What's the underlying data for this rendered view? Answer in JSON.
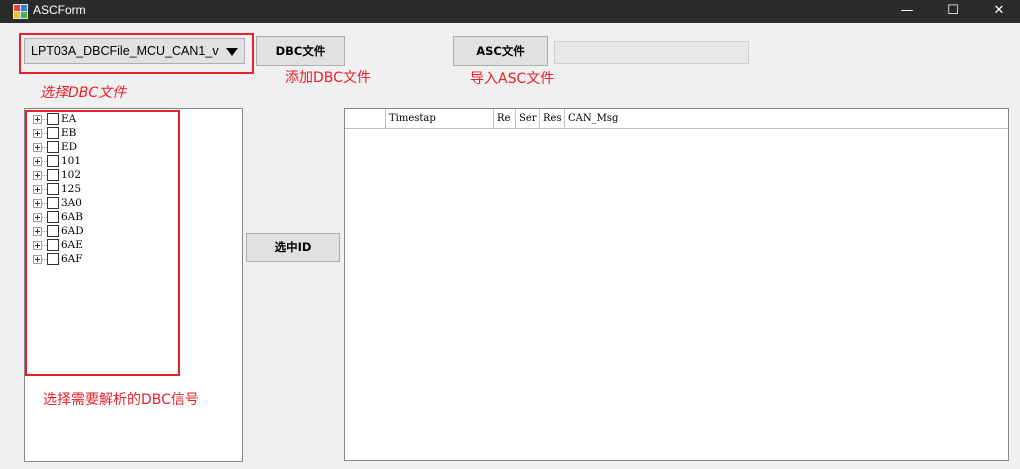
{
  "window": {
    "title": "ASCForm",
    "minimize_glyph": "—",
    "maximize_glyph": "☐",
    "close_glyph": "✕"
  },
  "controls": {
    "dbc_combo_value": "LPT03A_DBCFile_MCU_CAN1_v",
    "dbc_button_label": "DBC文件",
    "asc_button_label": "ASC文件",
    "asc_path_value": "",
    "select_id_button_label": "选中ID"
  },
  "annotations": {
    "select_dbc": "选择DBC文件",
    "add_dbc": "添加DBC文件",
    "import_asc": "导入ASC文件",
    "select_signals": "选择需要解析的DBC信号",
    "color": "#e8202a"
  },
  "tree": {
    "items": [
      "EA",
      "EB",
      "ED",
      "101",
      "102",
      "125",
      "3A0",
      "6AB",
      "6AD",
      "6AE",
      "6AF"
    ]
  },
  "grid": {
    "columns": [
      "",
      "Timestap",
      "Re",
      "Ser",
      "Res",
      "CAN_Msg"
    ]
  }
}
